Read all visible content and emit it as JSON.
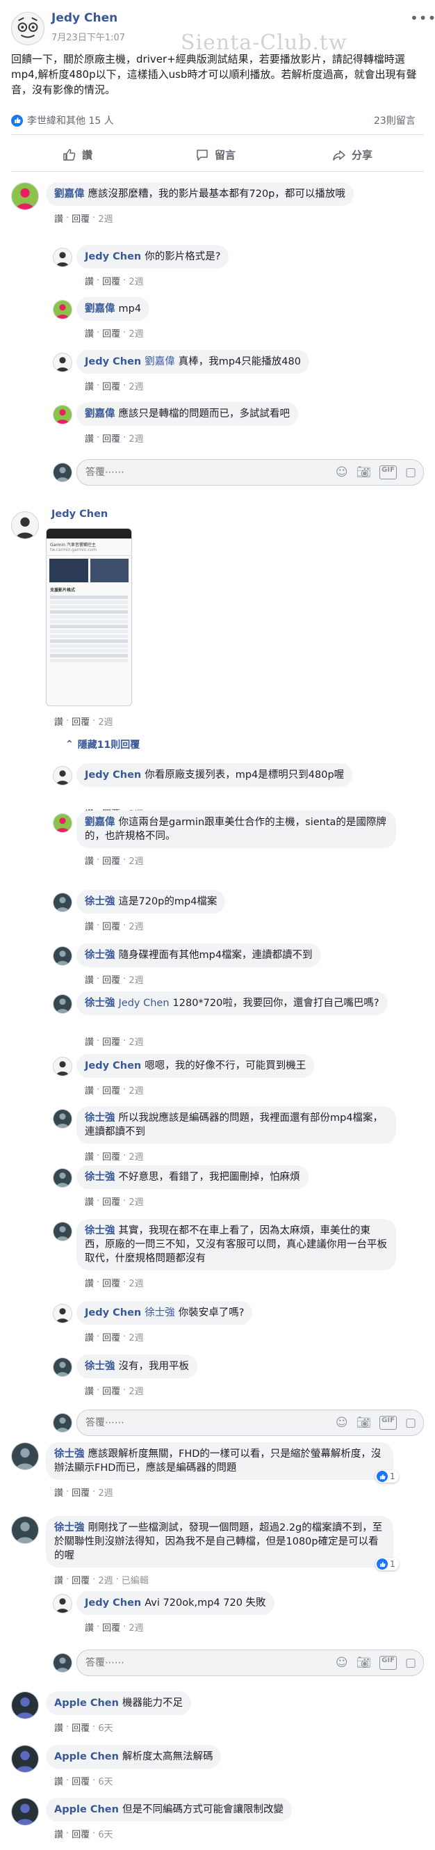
{
  "post": {
    "author": "Jedy Chen",
    "time": "7月23日下午1:07",
    "text": "回饋一下，關於原廠主機，driver+經典版測試結果，若要播放影片，請記得轉檔時選mp4,解析度480p以下，這樣插入usb時才可以順利播放。若解析度過高，就會出現有聲音，沒有影像的情況。",
    "watermark": "Sienta-Club.tw",
    "reactions_text": "李世緯和其他 15 人",
    "comments_count": "23則留言",
    "actions": {
      "like": "讚",
      "comment": "留言",
      "share": "分享"
    }
  },
  "labels": {
    "like": "讚",
    "reply": "回覆",
    "dot": "·",
    "edited": "已編輯"
  },
  "reply_placeholder": "答覆⋯⋯",
  "threads": [
    {
      "comment": {
        "author": "劉嘉偉",
        "text": "應該沒那麼糟，我的影片最基本都有720p，都可以播放哦",
        "time": "2週"
      },
      "replies": [
        {
          "author": "Jedy Chen",
          "text": "你的影片格式是?",
          "time": "2週"
        },
        {
          "author": "劉嘉偉",
          "text": "mp4",
          "time": "2週"
        },
        {
          "author": "Jedy Chen",
          "tag": "劉嘉偉",
          "text": "真棒，我mp4只能播放480",
          "time": "2週"
        },
        {
          "author": "劉嘉偉",
          "text": "應該只是轉檔的問題而已，多試試看吧",
          "time": "2週"
        }
      ]
    },
    {
      "comment": {
        "author": "Jedy Chen",
        "time": "2週"
      },
      "hidden_replies": "隱藏11則回覆",
      "screenshot": {
        "title": "Garmin 汽車音響觸控主",
        "url": "tw.carmin.garmin.com",
        "heading": "支援影片格式"
      },
      "replies": [
        {
          "author": "Jedy Chen",
          "text": "你看原廠支援列表，mp4是標明只到480p喔",
          "time": "2週"
        },
        {
          "author": "劉嘉偉",
          "text": "你這兩台是garmin跟車美仕合作的主機，sienta的是國際牌的，也許規格不同。",
          "time": "2週"
        },
        {
          "author": "徐士強",
          "text": "這是720p的mp4檔案",
          "time": "2週"
        },
        {
          "author": "徐士強",
          "text": "隨身碟裡面有其他mp4檔案，連讀都讀不到",
          "time": "2週"
        },
        {
          "author": "徐士強",
          "tag": "Jedy Chen",
          "text": "1280*720啦，我要回你，還會打自己嘴巴嗎?",
          "time": "2週"
        },
        {
          "author": "Jedy Chen",
          "text": "嗯嗯，我的好像不行，可能買到機王",
          "time": "2週"
        },
        {
          "author": "徐士強",
          "text": "所以我說應該是編碼器的問題，我裡面還有部份mp4檔案，連讀都讀不到",
          "time": "2週"
        },
        {
          "author": "徐士強",
          "text": "不好意思，看錯了，我把圖刪掉，怕麻煩",
          "time": "2週"
        },
        {
          "author": "徐士強",
          "text": "其實，我現在都不在車上看了，因為太麻煩，車美仕的東西，原廠的一問三不知，又沒有客服可以問，真心建議你用一台平板取代，什麼規格問題都沒有",
          "time": "2週"
        },
        {
          "author": "Jedy Chen",
          "tag": "徐士強",
          "text": "你裝安卓了嗎?",
          "time": "2週"
        },
        {
          "author": "徐士強",
          "text": "沒有，我用平板",
          "time": "2週"
        }
      ]
    },
    {
      "comment": {
        "author": "徐士強",
        "text": "應該跟解析度無關，FHD的一樣可以看，只是縮於螢幕解析度，沒辦法顯示FHD而已，應該是編碼器的問題",
        "time": "2週",
        "likes": "1"
      }
    },
    {
      "comment": {
        "author": "徐士強",
        "text": "剛剛找了一些檔測試，發現一個問題，超過2.2g的檔案讀不到，至於關聯性則沒辦法得知，因為我不是自己轉檔，但是1080p確定是可以看的喔",
        "time": "2週",
        "likes": "1"
      },
      "replies": [
        {
          "author": "Jedy Chen",
          "text": "Avi 720ok,mp4 720 失敗",
          "time": "2週"
        }
      ]
    },
    {
      "comment": {
        "author": "Apple Chen",
        "text": "機器能力不足",
        "time": "6天"
      }
    },
    {
      "comment": {
        "author": "Apple Chen",
        "text": "解析度太高無法解碼",
        "time": "6天"
      }
    },
    {
      "comment": {
        "author": "Apple Chen",
        "text": "但是不同編碼方式可能會讓限制改變",
        "time": "6天"
      }
    }
  ],
  "colors": {
    "link": "#385898",
    "bubble": "#f2f3f5",
    "like": "#1877f2",
    "meta": "#90949c"
  }
}
